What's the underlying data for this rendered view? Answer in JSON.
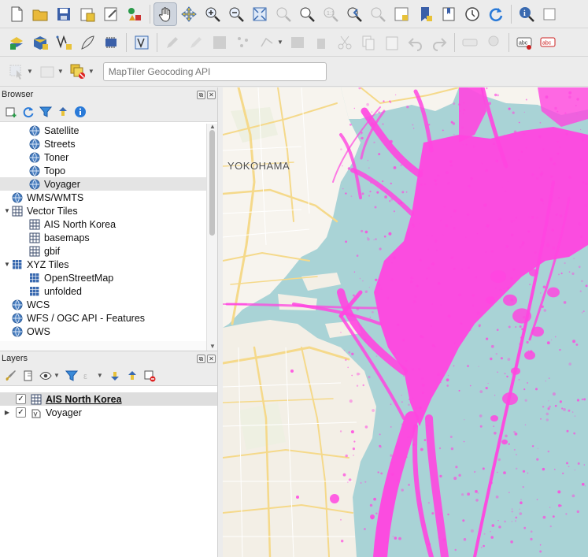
{
  "toolbar_search": {
    "placeholder": "MapTiler Geocoding API"
  },
  "browser": {
    "title": "Browser",
    "items": [
      {
        "label": "Satellite",
        "icon": "globe-icon",
        "level": 1
      },
      {
        "label": "Streets",
        "icon": "globe-icon",
        "level": 1
      },
      {
        "label": "Toner",
        "icon": "globe-icon",
        "level": 1
      },
      {
        "label": "Topo",
        "icon": "globe-icon",
        "level": 1
      },
      {
        "label": "Voyager",
        "icon": "globe-icon",
        "level": 1,
        "selected": true
      },
      {
        "label": "WMS/WMTS",
        "icon": "globe-icon",
        "level": 0
      },
      {
        "label": "Vector Tiles",
        "icon": "grid-icon",
        "level": 0,
        "expanded": true
      },
      {
        "label": "AIS North Korea",
        "icon": "grid-icon",
        "level": 1
      },
      {
        "label": "basemaps",
        "icon": "grid-icon",
        "level": 1
      },
      {
        "label": "gbif",
        "icon": "grid-icon",
        "level": 1
      },
      {
        "label": "XYZ Tiles",
        "icon": "xyz-grid-icon",
        "level": 0,
        "expanded": true
      },
      {
        "label": "OpenStreetMap",
        "icon": "xyz-grid-icon",
        "level": 1
      },
      {
        "label": "unfolded",
        "icon": "xyz-grid-icon",
        "level": 1
      },
      {
        "label": "WCS",
        "icon": "globe-icon",
        "level": 0
      },
      {
        "label": "WFS / OGC API - Features",
        "icon": "globe-icon",
        "level": 0
      },
      {
        "label": "OWS",
        "icon": "globe-icon",
        "level": 0
      }
    ]
  },
  "layers": {
    "title": "Layers",
    "items": [
      {
        "label": "AIS North Korea",
        "checked": true,
        "selected": true,
        "icon": "grid-icon"
      },
      {
        "label": "Voyager",
        "checked": true,
        "selected": false,
        "icon": "vector-tile-icon",
        "collapsible": true
      }
    ]
  },
  "map": {
    "place_label": "YOKOHAMA",
    "colors": {
      "water": "#a9d3d6",
      "land": "#f7f4ee",
      "road": "#f5d98a",
      "ais": "#ff45e0"
    }
  }
}
